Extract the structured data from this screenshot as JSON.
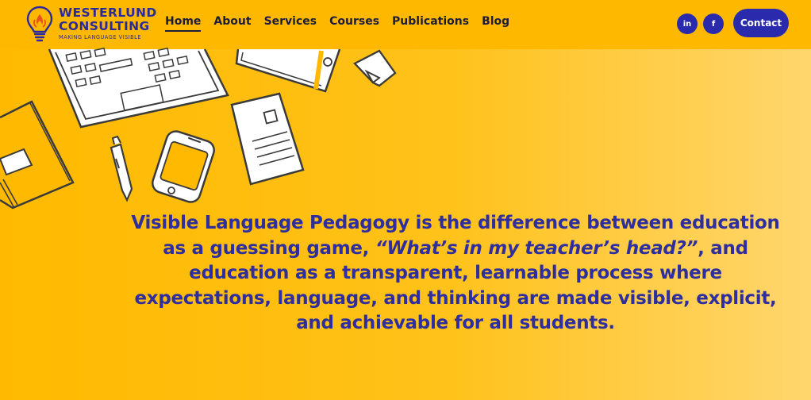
{
  "brand": {
    "name_line1": "WESTERLUND",
    "name_line2": "CONSULTING",
    "tagline": "MAKING LANGUAGE VISIBLE"
  },
  "nav": {
    "items": [
      {
        "label": "Home",
        "active": true
      },
      {
        "label": "About"
      },
      {
        "label": "Services"
      },
      {
        "label": "Courses"
      },
      {
        "label": "Publications"
      },
      {
        "label": "Blog"
      }
    ]
  },
  "social": {
    "linkedin_label": "in",
    "facebook_label": "f"
  },
  "contact_label": "Contact",
  "hero": {
    "part1": "Visible Language Pedagogy is the difference between education as a guessing game, ",
    "quote": "“What’s in my teacher’s head?”",
    "part2": ", and education as a transparent, learnable process where expectations, language, and thinking are made visible, explicit, and achievable for all students."
  },
  "colors": {
    "background": "#ffb900",
    "accent": "#2a2aad",
    "text_dark": "#1d1d3a"
  },
  "icons": [
    "lightbulb-logo-icon",
    "laptop-icon",
    "notebook-icon",
    "sticky-note-icon",
    "book-icon",
    "pen-icon",
    "phone-icon",
    "document-icon"
  ]
}
